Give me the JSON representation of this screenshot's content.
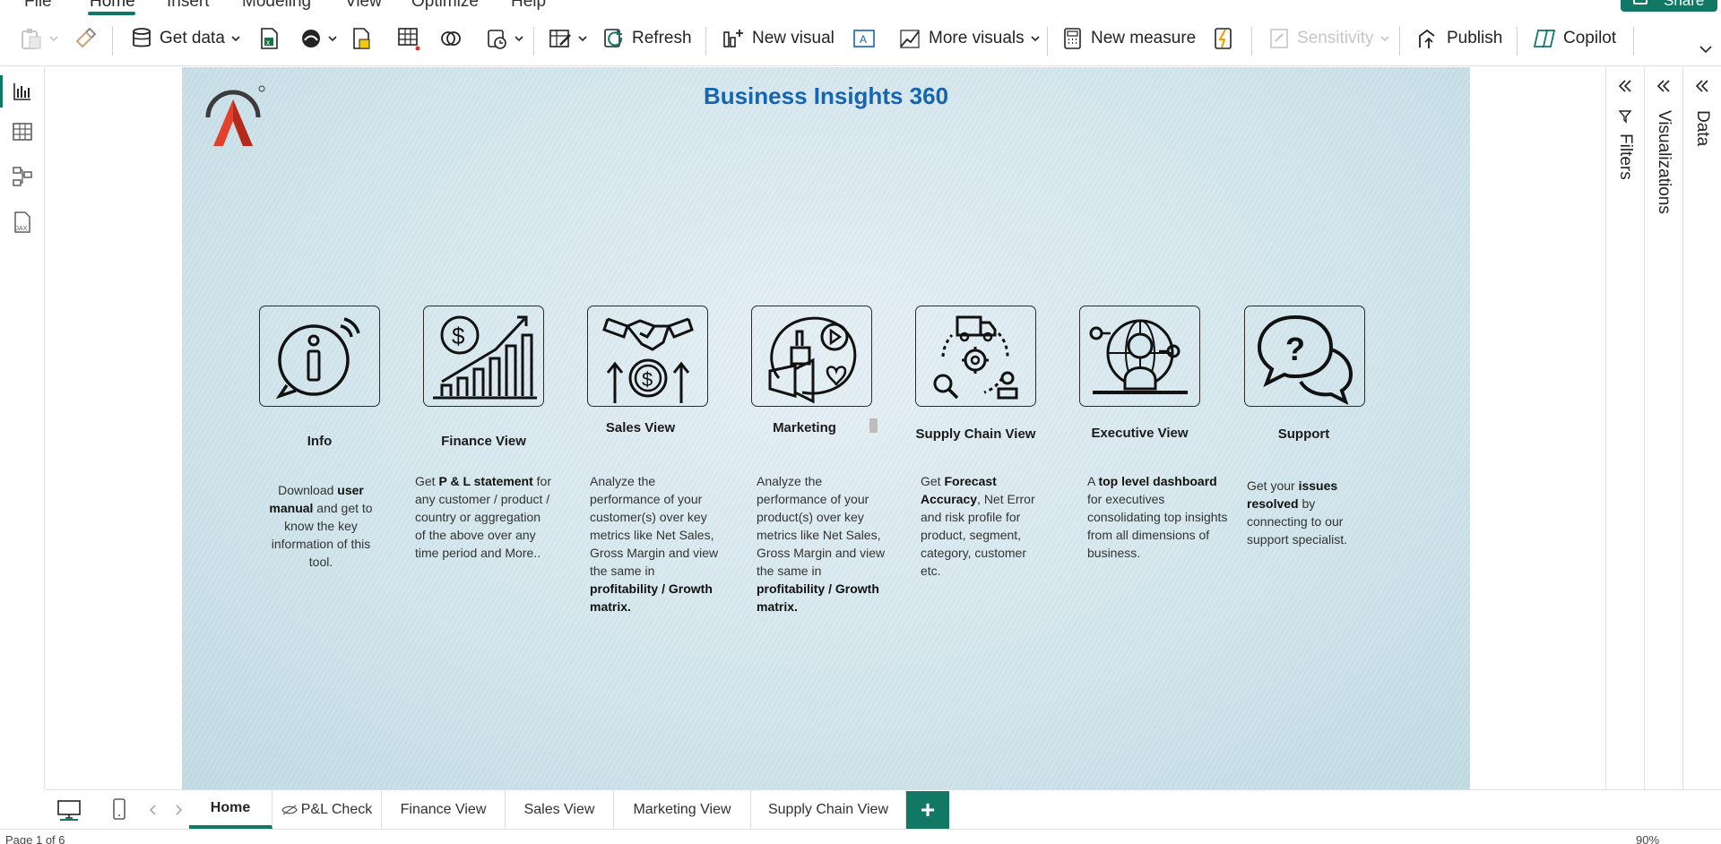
{
  "menu": {
    "tabs": [
      "File",
      "Home",
      "Insert",
      "Modeling",
      "View",
      "Optimize",
      "Help"
    ],
    "active": "Home",
    "share_label": "Share"
  },
  "ribbon": {
    "get_data": "Get data",
    "refresh": "Refresh",
    "new_visual": "New visual",
    "more_visuals": "More visuals",
    "new_measure": "New measure",
    "sensitivity": "Sensitivity",
    "publish": "Publish",
    "copilot": "Copilot"
  },
  "report": {
    "title": "Business Insights 360",
    "cards": [
      {
        "title": "Info",
        "desc_parts": [
          [
            "Download ",
            false
          ],
          [
            "user manual",
            true
          ],
          [
            " and get to know the key information of this tool.",
            false
          ]
        ]
      },
      {
        "title": "Finance View",
        "desc_parts": [
          [
            "Get  ",
            false
          ],
          [
            "P & L statement",
            true
          ],
          [
            " for any customer / product / country or aggregation of the above over any time period and More..",
            false
          ]
        ]
      },
      {
        "title": "Sales View",
        "desc_parts": [
          [
            "Analyze the performance of your customer(s) over key metrics like Net Sales, Gross Margin and view the same in ",
            false
          ],
          [
            "profitability / Growth matrix.",
            true
          ]
        ]
      },
      {
        "title": "Marketing",
        "desc_parts": [
          [
            "Analyze the performance of your product(s) over key metrics like Net Sales, Gross Margin and view the same in ",
            false
          ],
          [
            "profitability / Growth matrix.",
            true
          ]
        ]
      },
      {
        "title": "Supply Chain View",
        "desc_parts": [
          [
            "Get ",
            false
          ],
          [
            "Forecast Accuracy",
            true
          ],
          [
            ", Net Error and risk profile for product, segment, category, customer etc.",
            false
          ]
        ]
      },
      {
        "title": "Executive View",
        "desc_parts": [
          [
            "A ",
            false
          ],
          [
            "top level dashboard",
            true
          ],
          [
            " for executives consolidating top insights from all dimensions of business.",
            false
          ]
        ]
      },
      {
        "title": "Support",
        "desc_parts": [
          [
            "Get your ",
            false
          ],
          [
            "issues resolved",
            true
          ],
          [
            " by connecting to our support specialist.",
            false
          ]
        ]
      }
    ]
  },
  "panes": {
    "filters": "Filters",
    "visualizations": "Visualizations",
    "data": "Data"
  },
  "pages": {
    "tabs": [
      "Home",
      "P&L Check",
      "Finance View",
      "Sales View",
      "Marketing View",
      "Supply Chain View"
    ],
    "active": "Home",
    "add_label": "+"
  },
  "status": {
    "page_label": "Page 1 of 6",
    "zoom": "90%"
  },
  "colors": {
    "accent": "#117865",
    "title_blue": "#1565b0"
  },
  "icons": [
    "info-icon",
    "finance-icon",
    "sales-icon",
    "marketing-icon",
    "supply-chain-icon",
    "executive-icon",
    "support-icon"
  ]
}
